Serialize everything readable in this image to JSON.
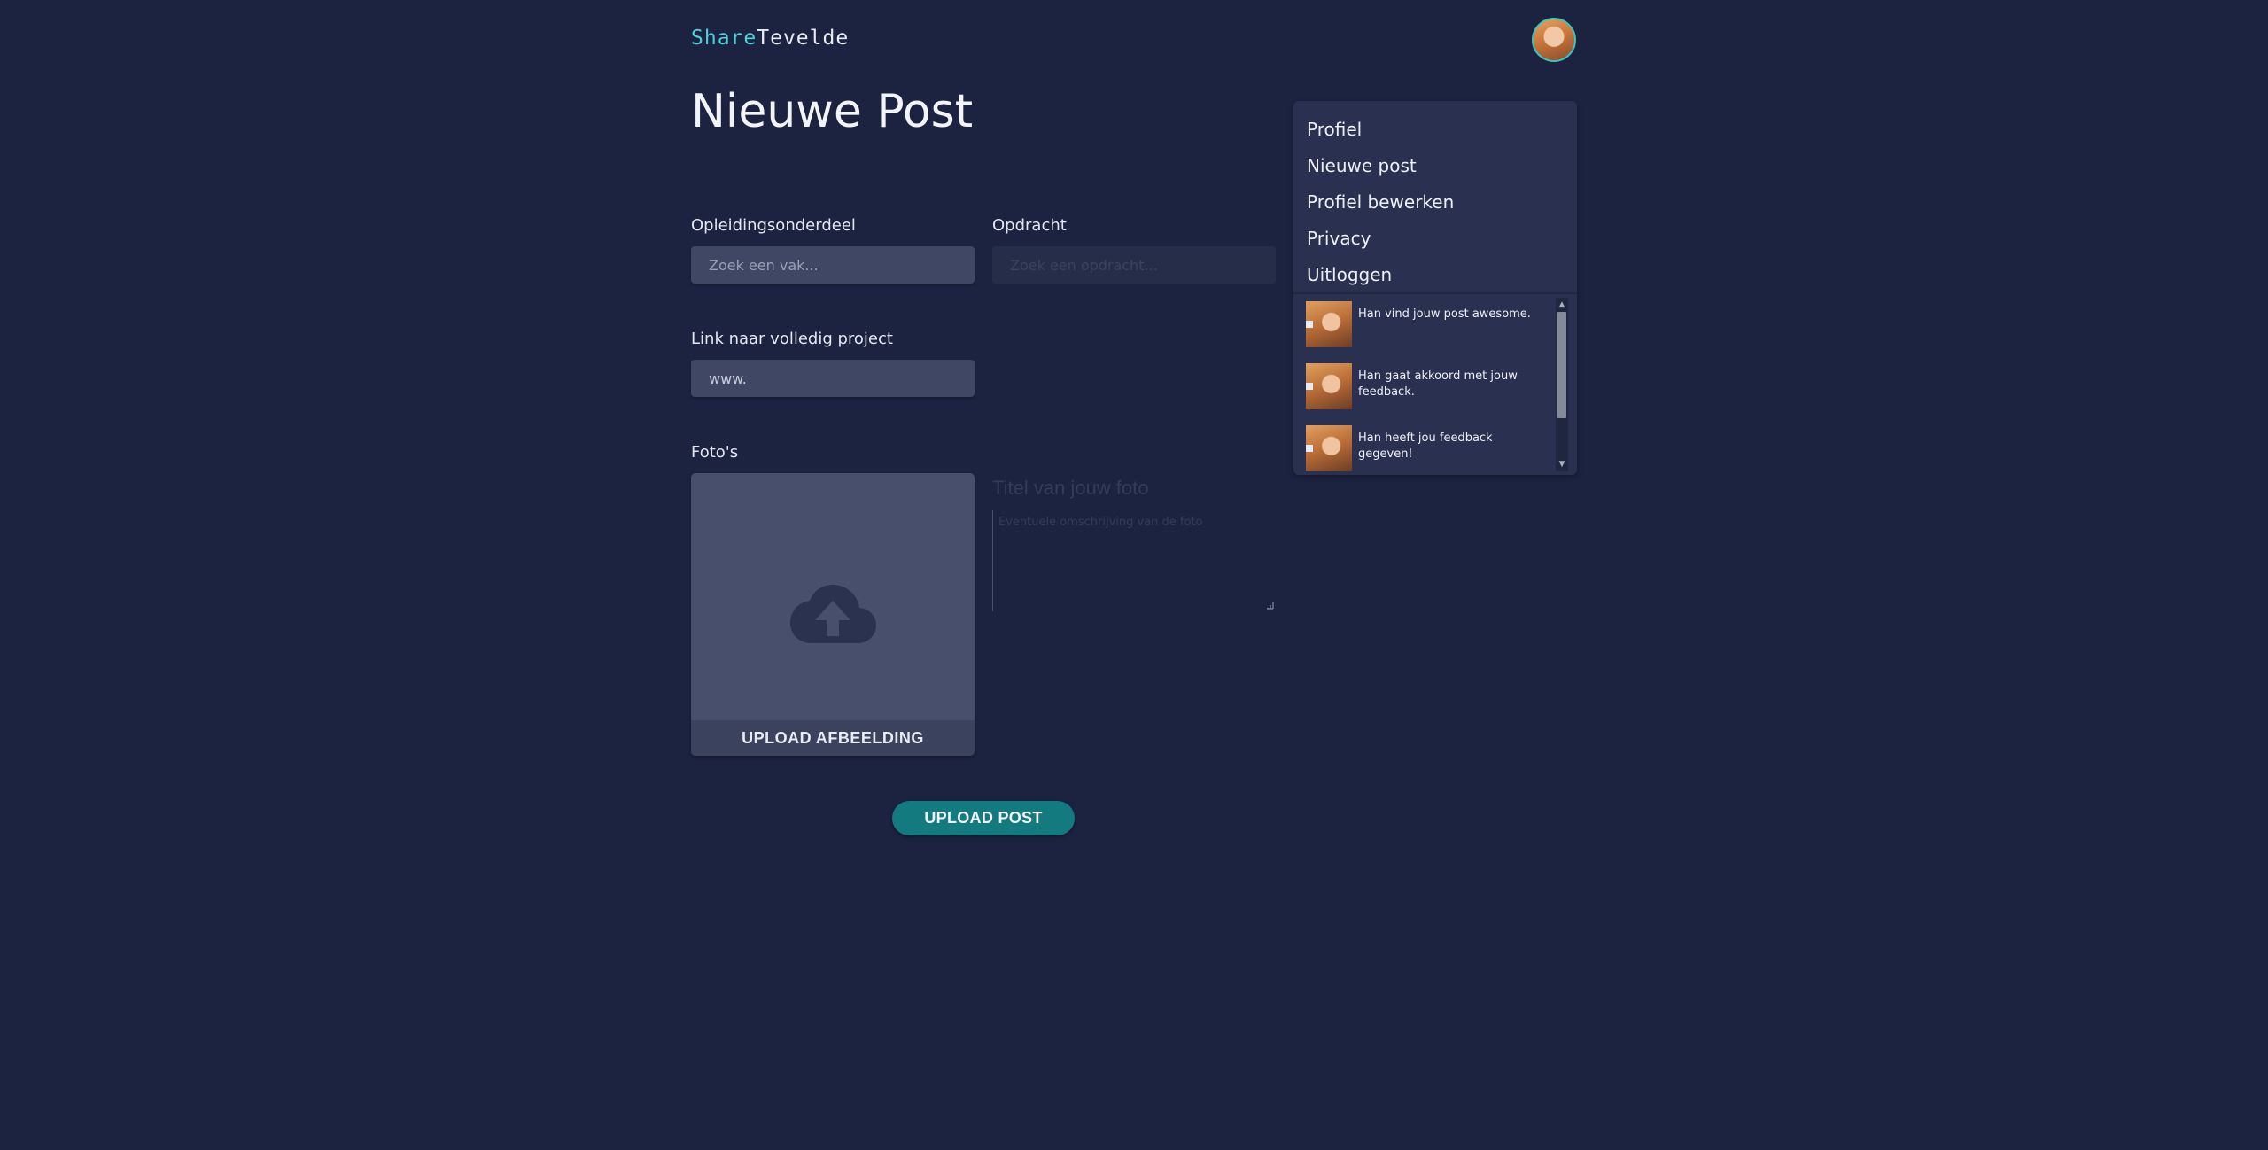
{
  "brand": {
    "part1": "Share",
    "part2": "Tevelde",
    "accent_color": "#4fd1db"
  },
  "header": {
    "avatar_icon": "user-avatar"
  },
  "page": {
    "title": "Nieuwe Post"
  },
  "form": {
    "course_label": "Opleidingsonderdeel",
    "course_placeholder": "Zoek een vak...",
    "assignment_label": "Opdracht",
    "assignment_placeholder": "Zoek een opdracht...",
    "link_label": "Link naar volledig project",
    "link_value": "www.",
    "photos_label": "Foto's",
    "upload_image_label": "UPLOAD AFBEELDING",
    "upload_icon": "cloud-upload-icon",
    "photo_title_placeholder": "Titel van jouw foto",
    "photo_desc_placeholder": "Eventuele omschrijving van de foto",
    "submit_label": "UPLOAD POST",
    "submit_color": "#137b80"
  },
  "menu": {
    "items": [
      {
        "label": "Profiel"
      },
      {
        "label": "Nieuwe post"
      },
      {
        "label": "Profiel bewerken"
      },
      {
        "label": "Privacy"
      },
      {
        "label": "Uitloggen"
      }
    ],
    "notifications": [
      {
        "text": "Han vind jouw post awesome."
      },
      {
        "text": "Han gaat akkoord met jouw feedback."
      },
      {
        "text": "Han heeft jou feedback gegeven!"
      }
    ]
  }
}
